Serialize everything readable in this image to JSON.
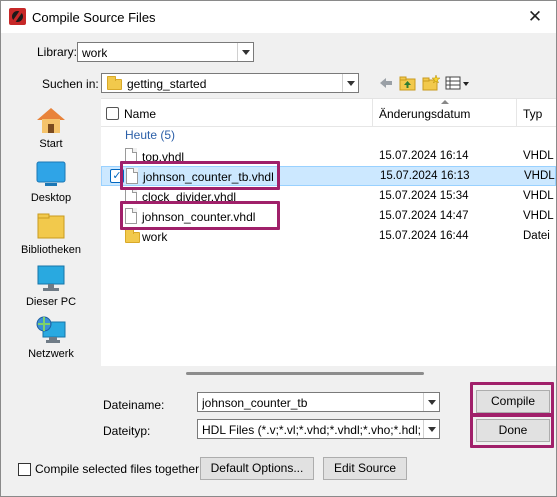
{
  "window": {
    "title": "Compile Source Files",
    "close_glyph": "✕"
  },
  "library": {
    "label": "Library:",
    "value": "work"
  },
  "look_in": {
    "label": "Suchen in:",
    "value": "getting_started"
  },
  "toolbar": {
    "icons": [
      "back-arrow-icon",
      "up-folder-icon",
      "new-folder-icon",
      "view-menu-icon"
    ]
  },
  "places": [
    {
      "label": "Start",
      "icon": "home-icon"
    },
    {
      "label": "Desktop",
      "icon": "desktop-icon"
    },
    {
      "label": "Bibliotheken",
      "icon": "libraries-icon"
    },
    {
      "label": "Dieser PC",
      "icon": "computer-icon"
    },
    {
      "label": "Netzwerk",
      "icon": "network-icon"
    }
  ],
  "list": {
    "columns": {
      "name": "Name",
      "date": "Änderungsdatum",
      "type": "Typ"
    },
    "group_label": "Heute (5)",
    "rows": [
      {
        "name": "top.vhdl",
        "date": "15.07.2024 16:14",
        "type": "VHDL",
        "kind": "file",
        "selected": false
      },
      {
        "name": "johnson_counter_tb.vhdl",
        "date": "15.07.2024 16:13",
        "type": "VHDL",
        "kind": "file",
        "selected": true
      },
      {
        "name": "clock_divider.vhdl",
        "date": "15.07.2024 15:34",
        "type": "VHDL",
        "kind": "file",
        "selected": false
      },
      {
        "name": "johnson_counter.vhdl",
        "date": "15.07.2024 14:47",
        "type": "VHDL",
        "kind": "file",
        "selected": false
      },
      {
        "name": "work",
        "date": "15.07.2024 16:44",
        "type": "Datei",
        "kind": "folder",
        "selected": false
      }
    ]
  },
  "filename": {
    "label": "Dateiname:",
    "value": "johnson_counter_tb"
  },
  "filetype": {
    "label": "Dateityp:",
    "value": "HDL Files (*.v;*.vl;*.vhd;*.vhdl;*.vho;*.hdl;*.vo;*"
  },
  "buttons": {
    "compile": "Compile",
    "done": "Done",
    "default_options": "Default Options...",
    "edit_source": "Edit Source"
  },
  "compile_together": {
    "label": "Compile selected files together",
    "checked": false
  },
  "colors": {
    "highlight": "#a0206a",
    "selection": "#cce8ff",
    "group_text": "#2b5fa8"
  }
}
